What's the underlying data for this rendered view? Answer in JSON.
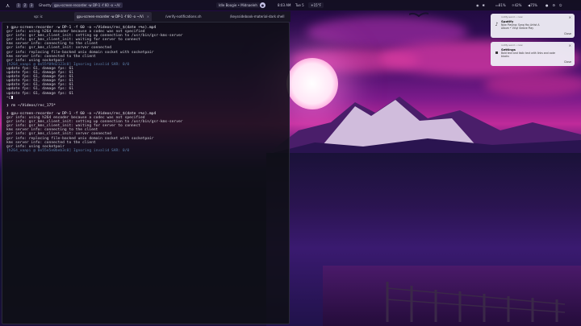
{
  "topbar": {
    "logo": "⋏",
    "workspaces": [
      "1",
      "2",
      "3"
    ],
    "window_title": "Ghostty",
    "active_window": "gpu-screen-recorder -w DP-1 -f 60 -o ~/V",
    "media": "Idle Boogie • Midnaeleh",
    "clock": "8:03 AM",
    "date": "Tue 5",
    "weather": "15°F",
    "tray_items": [
      "",
      "",
      "⚇",
      "◐"
    ],
    "battery": "81%",
    "brightness": "42%",
    "volume": "75%",
    "power_icon": "power-icon"
  },
  "tabs": [
    {
      "label": "vp: ic"
    },
    {
      "label": "gpu-screen-recorder -w DP-1 -f 60 -o ~/Vi",
      "active": true
    },
    {
      "label": "/verify-notifications.sh"
    },
    {
      "label": "/keyssidebook-material-dark shell"
    }
  ],
  "terminal": {
    "lines": [
      {
        "t": "❯ gpu-screen-recorder -w DP-1 -f 60 -o ~/Videos/rec_$(date +%s).mp4",
        "c": "white"
      },
      {
        "t": "gsr info: using h264 encoder because a codec was not specified",
        "c": ""
      },
      {
        "t": "gsr info: gsr_kms_client_init: setting up connection to /usr/bin/gsr-kms-server",
        "c": ""
      },
      {
        "t": "gsr info: gsr_kms_client_init: waiting for server to connect",
        "c": ""
      },
      {
        "t": "kms server info: connecting to the client",
        "c": ""
      },
      {
        "t": "gsr info: gsr_kms_client_init: server connected",
        "c": ""
      },
      {
        "t": "gsr info: replacing file-backed unix domain socket with socketpair",
        "c": ""
      },
      {
        "t": "kms server info: connected to the client",
        "c": ""
      },
      {
        "t": "gsr info: using socketpair",
        "c": ""
      },
      {
        "t": "[h264_vaapi @ 0x55f09d2123c0] Ignoring invalid SAR: 0/0",
        "c": "dim"
      },
      {
        "t": "update fps: 61, damage fps: 61",
        "c": ""
      },
      {
        "t": "update fps: 61, damage fps: 61",
        "c": ""
      },
      {
        "t": "update fps: 61, damage fps: 61",
        "c": ""
      },
      {
        "t": "update fps: 61, damage fps: 61",
        "c": ""
      },
      {
        "t": "update fps: 61, damage fps: 61",
        "c": ""
      },
      {
        "t": "update fps: 61, damage fps: 61",
        "c": ""
      },
      {
        "t": "update fps: 61, damage fps: 61",
        "c": ""
      },
      {
        "t": "^C",
        "c": "",
        "cursor": true
      },
      {
        "t": "",
        "c": ""
      },
      {
        "t": "❯ rm ~/Videos/rec_175*",
        "c": "white"
      },
      {
        "t": "",
        "c": ""
      },
      {
        "t": "❯ gpu-screen-recorder -w DP-1 -f 60 -o ~/Videos/rec_$(date +%s).mp4",
        "c": "white"
      },
      {
        "t": "gsr info: using h264 encoder because a codec was not specified",
        "c": ""
      },
      {
        "t": "gsr info: gsr_kms_client_init: setting up connection to /usr/bin/gsr-kms-server",
        "c": ""
      },
      {
        "t": "gsr info: gsr_kms_client_init: waiting for server to connect",
        "c": ""
      },
      {
        "t": "kms server info: connecting to the client",
        "c": ""
      },
      {
        "t": "gsr info: gsr_kms_client_init: server connected",
        "c": ""
      },
      {
        "t": "gsr info: replacing file-backed unix domain socket with socketpair",
        "c": ""
      },
      {
        "t": "kms server info: connected to the client",
        "c": ""
      },
      {
        "t": "gsr info: using socketpair",
        "c": ""
      },
      {
        "t": "[h264_vaapi @ 0x55e5e0beb3c0] Ignoring invalid SAR: 0/0",
        "c": "dim"
      }
    ]
  },
  "notifications": [
    {
      "app": "notify-send • now",
      "title": "Spotify",
      "body1": "Now Playing: Song You Artist A",
      "body2": "Album • Vinyl Sleeve Play",
      "close": "Close"
    },
    {
      "app": "notify-send • now",
      "title": "Settings",
      "body1": "Bold text and italic text with links and code",
      "body2": "blocks",
      "close": "Close"
    }
  ],
  "colors": {
    "accent": "#8fdc6e",
    "prompt": "#e8e8f0",
    "log_dim": "#5c7fa8",
    "notif_bg": "#eceaf4"
  }
}
